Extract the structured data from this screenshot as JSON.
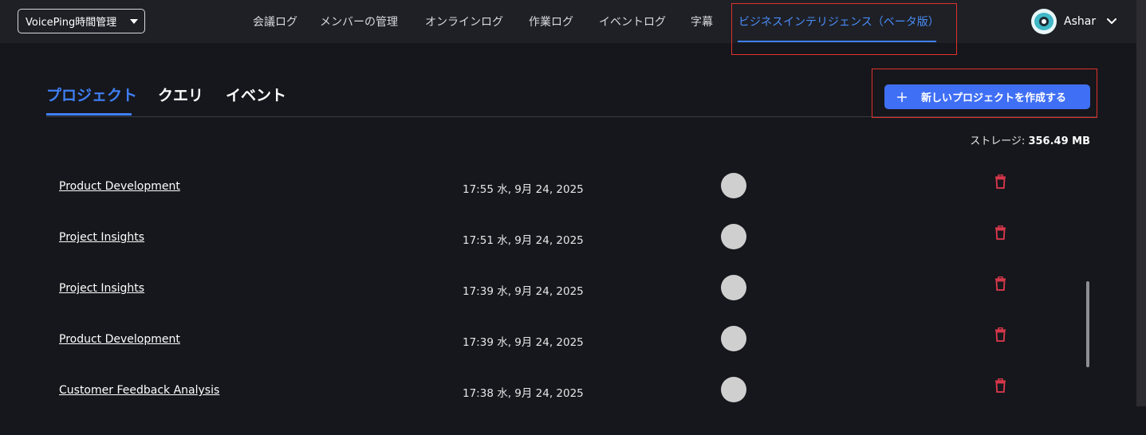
{
  "workspace": {
    "selected": "VoicePing時間管理"
  },
  "nav": {
    "items": [
      {
        "label": "会議ログ"
      },
      {
        "label": "メンバーの管理"
      },
      {
        "label": "オンラインログ"
      },
      {
        "label": "作業ログ"
      },
      {
        "label": "イベントログ"
      },
      {
        "label": "字幕"
      },
      {
        "label": "ビジネスインテリジェンス（ベータ版）"
      }
    ],
    "active": "ビジネスインテリジェンス（ベータ版）"
  },
  "user": {
    "name": "Ashar",
    "avatar_icon": "eye-avatar-icon"
  },
  "tabs": {
    "items": [
      {
        "label": "プロジェクト"
      },
      {
        "label": "クエリ"
      },
      {
        "label": "イベント"
      }
    ],
    "active": "プロジェクト"
  },
  "create_button": {
    "label": "新しいプロジェクトを作成する",
    "icon": "plus-icon"
  },
  "storage": {
    "label": "ストレージ:",
    "value": "356.49 MB"
  },
  "projects": [
    {
      "name": "Product Development",
      "date": "17:55 水, 9月 24, 2025"
    },
    {
      "name": "Project Insights",
      "date": "17:51 水, 9月 24, 2025"
    },
    {
      "name": "Project Insights",
      "date": "17:39 水, 9月 24, 2025"
    },
    {
      "name": "Product Development",
      "date": "17:39 水, 9月 24, 2025"
    },
    {
      "name": "Customer Feedback Analysis",
      "date": "17:38 水, 9月 24, 2025"
    }
  ],
  "colors": {
    "accent": "#3f7ff5",
    "highlight": "#e0312a",
    "delete": "#e0394d",
    "background": "#16171c",
    "topbar": "#1e2026"
  }
}
